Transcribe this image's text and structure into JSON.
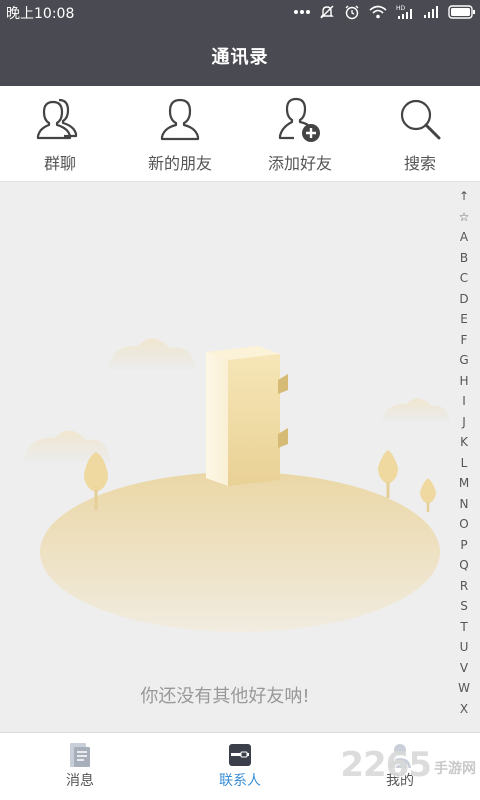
{
  "status_bar": {
    "time": "晚上10:08",
    "icons": [
      "more-dots-icon",
      "mute-icon",
      "alarm-icon",
      "wifi-icon",
      "hd-signal-icon",
      "signal-icon",
      "battery-icon"
    ]
  },
  "header": {
    "title": "通讯录"
  },
  "actions": [
    {
      "label": "群聊",
      "icon": "group-chat-icon"
    },
    {
      "label": "新的朋友",
      "icon": "new-friend-icon"
    },
    {
      "label": "添加好友",
      "icon": "add-friend-icon"
    },
    {
      "label": "搜索",
      "icon": "search-icon"
    }
  ],
  "empty_state": {
    "message": "你还没有其他好友呐!"
  },
  "alphabet_index": [
    "↑",
    "☆",
    "A",
    "B",
    "C",
    "D",
    "E",
    "F",
    "G",
    "H",
    "I",
    "J",
    "K",
    "L",
    "M",
    "N",
    "O",
    "P",
    "Q",
    "R",
    "S",
    "T",
    "U",
    "V",
    "W",
    "X"
  ],
  "bottom_nav": [
    {
      "label": "消息",
      "icon": "message-icon",
      "active": false
    },
    {
      "label": "联系人",
      "icon": "contacts-icon",
      "active": true
    },
    {
      "label": "我的",
      "icon": "profile-icon",
      "active": false
    }
  ],
  "watermark": {
    "number": "2265",
    "suffix": "手游网"
  },
  "colors": {
    "header_bg": "#4a4a52",
    "accent": "#3a8fd6",
    "page_bg": "#eeeeee",
    "illustration": "#e9d7a8"
  }
}
